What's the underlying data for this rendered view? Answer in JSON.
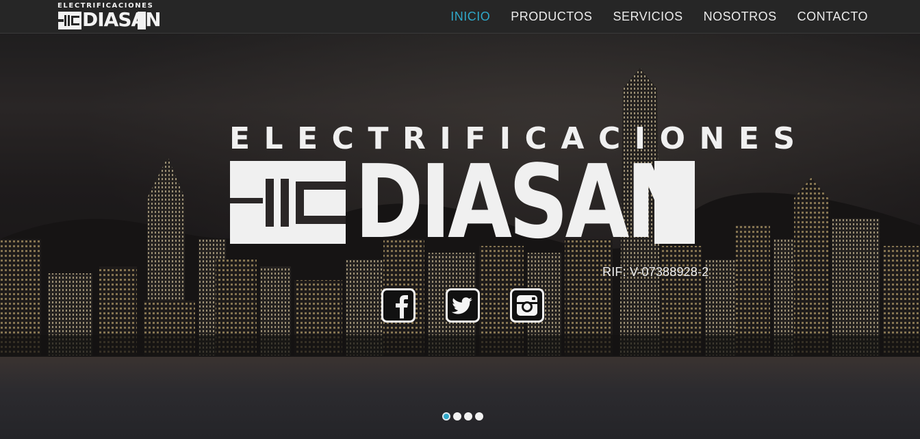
{
  "brand": {
    "tagline": "ELECTRIFICACIONES",
    "name": "DIASAN"
  },
  "nav": {
    "items": [
      {
        "label": "INICIO",
        "active": true
      },
      {
        "label": "PRODUCTOS",
        "active": false
      },
      {
        "label": "SERVICIOS",
        "active": false
      },
      {
        "label": "NOSOTROS",
        "active": false
      },
      {
        "label": "CONTACTO",
        "active": false
      }
    ]
  },
  "hero": {
    "logo_top": "ELECTRIFICACIONES",
    "logo_name": "DIASAN",
    "rif": "RIF: V-07388928-2",
    "social": [
      "facebook-icon",
      "twitter-icon",
      "instagram-icon"
    ],
    "slides": {
      "count": 4,
      "active": 1
    }
  },
  "colors": {
    "accent": "#2fa8c9",
    "nav_bg": "#262626",
    "text": "#f0f0f0"
  }
}
